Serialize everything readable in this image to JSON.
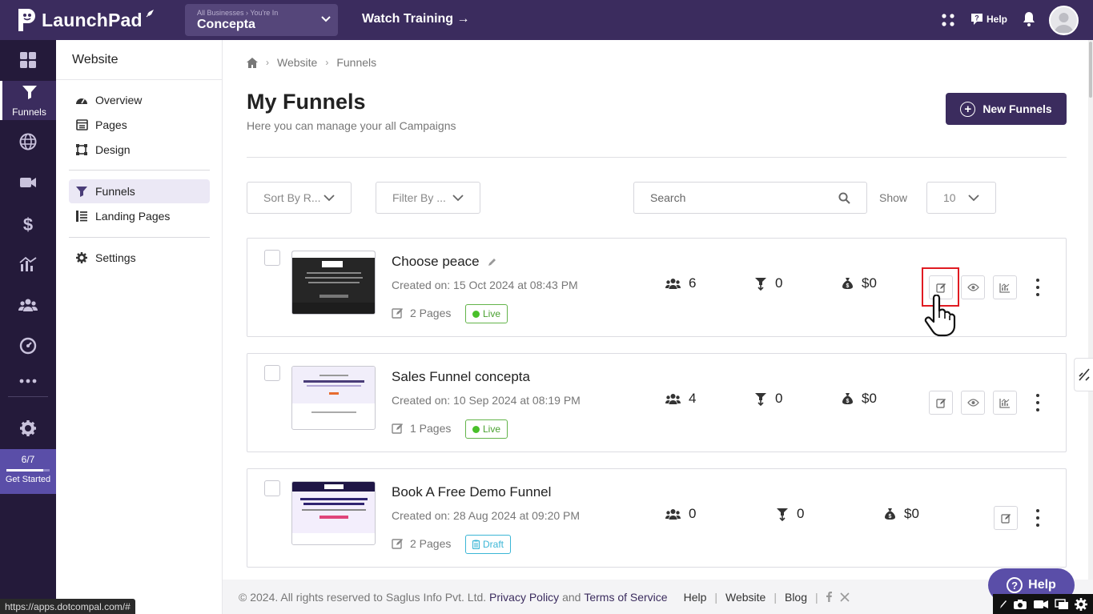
{
  "app": {
    "name": "LaunchPad"
  },
  "business": {
    "crumb": "All Businesses › You're In",
    "name": "Concepta"
  },
  "topbar": {
    "watch_training": "Watch Training →",
    "help": "Help"
  },
  "rail": {
    "active_label": "Funnels",
    "get_started": {
      "count": "6/7",
      "label": "Get Started",
      "progress": 0.857
    }
  },
  "sidebar": {
    "title": "Website",
    "items": [
      {
        "label": "Overview",
        "icon": "gauge-icon"
      },
      {
        "label": "Pages",
        "icon": "browser-window-icon"
      },
      {
        "label": "Design",
        "icon": "design-grid-icon"
      },
      {
        "label": "Funnels",
        "icon": "funnel-icon",
        "active": true
      },
      {
        "label": "Landing Pages",
        "icon": "list-icon"
      },
      {
        "label": "Settings",
        "icon": "gear-icon"
      }
    ]
  },
  "breadcrumb": [
    "Website",
    "Funnels"
  ],
  "page": {
    "title": "My Funnels",
    "subtitle": "Here you can manage your all Campaigns",
    "new_button": "New Funnels"
  },
  "filters": {
    "sort": "Sort By R...",
    "filter": "Filter By ...",
    "search_placeholder": "Search",
    "show_label": "Show",
    "show_value": "10"
  },
  "funnels": [
    {
      "name": "Choose peace",
      "created": "Created on: 15 Oct 2024 at 08:43 PM",
      "pages": "2 Pages",
      "status": "Live",
      "visitors": "6",
      "conversions": "0",
      "revenue": "$0"
    },
    {
      "name": "Sales Funnel concepta",
      "created": "Created on: 10 Sep 2024 at 08:19 PM",
      "pages": "1 Pages",
      "status": "Live",
      "visitors": "4",
      "conversions": "0",
      "revenue": "$0"
    },
    {
      "name": "Book A Free Demo Funnel",
      "created": "Created on: 28 Aug 2024 at 09:20 PM",
      "pages": "2 Pages",
      "status": "Draft",
      "visitors": "0",
      "conversions": "0",
      "revenue": "$0"
    }
  ],
  "footer": {
    "copyright": "©  2024. All rights reserved to Saglus Info Pvt. Ltd.",
    "privacy": "Privacy Policy",
    "and": "and",
    "terms": "Terms of Service",
    "links": [
      "Help",
      "Website",
      "Blog"
    ]
  },
  "help_button": "Help",
  "status_url": "https://apps.dotcompal.com/#",
  "colors": {
    "brand": "#3b2c5e",
    "rail": "#241a3a",
    "accent": "#5a4ea8",
    "live": "#49a02f",
    "draft": "#3bb6d6",
    "highlight": "#e01b22"
  }
}
